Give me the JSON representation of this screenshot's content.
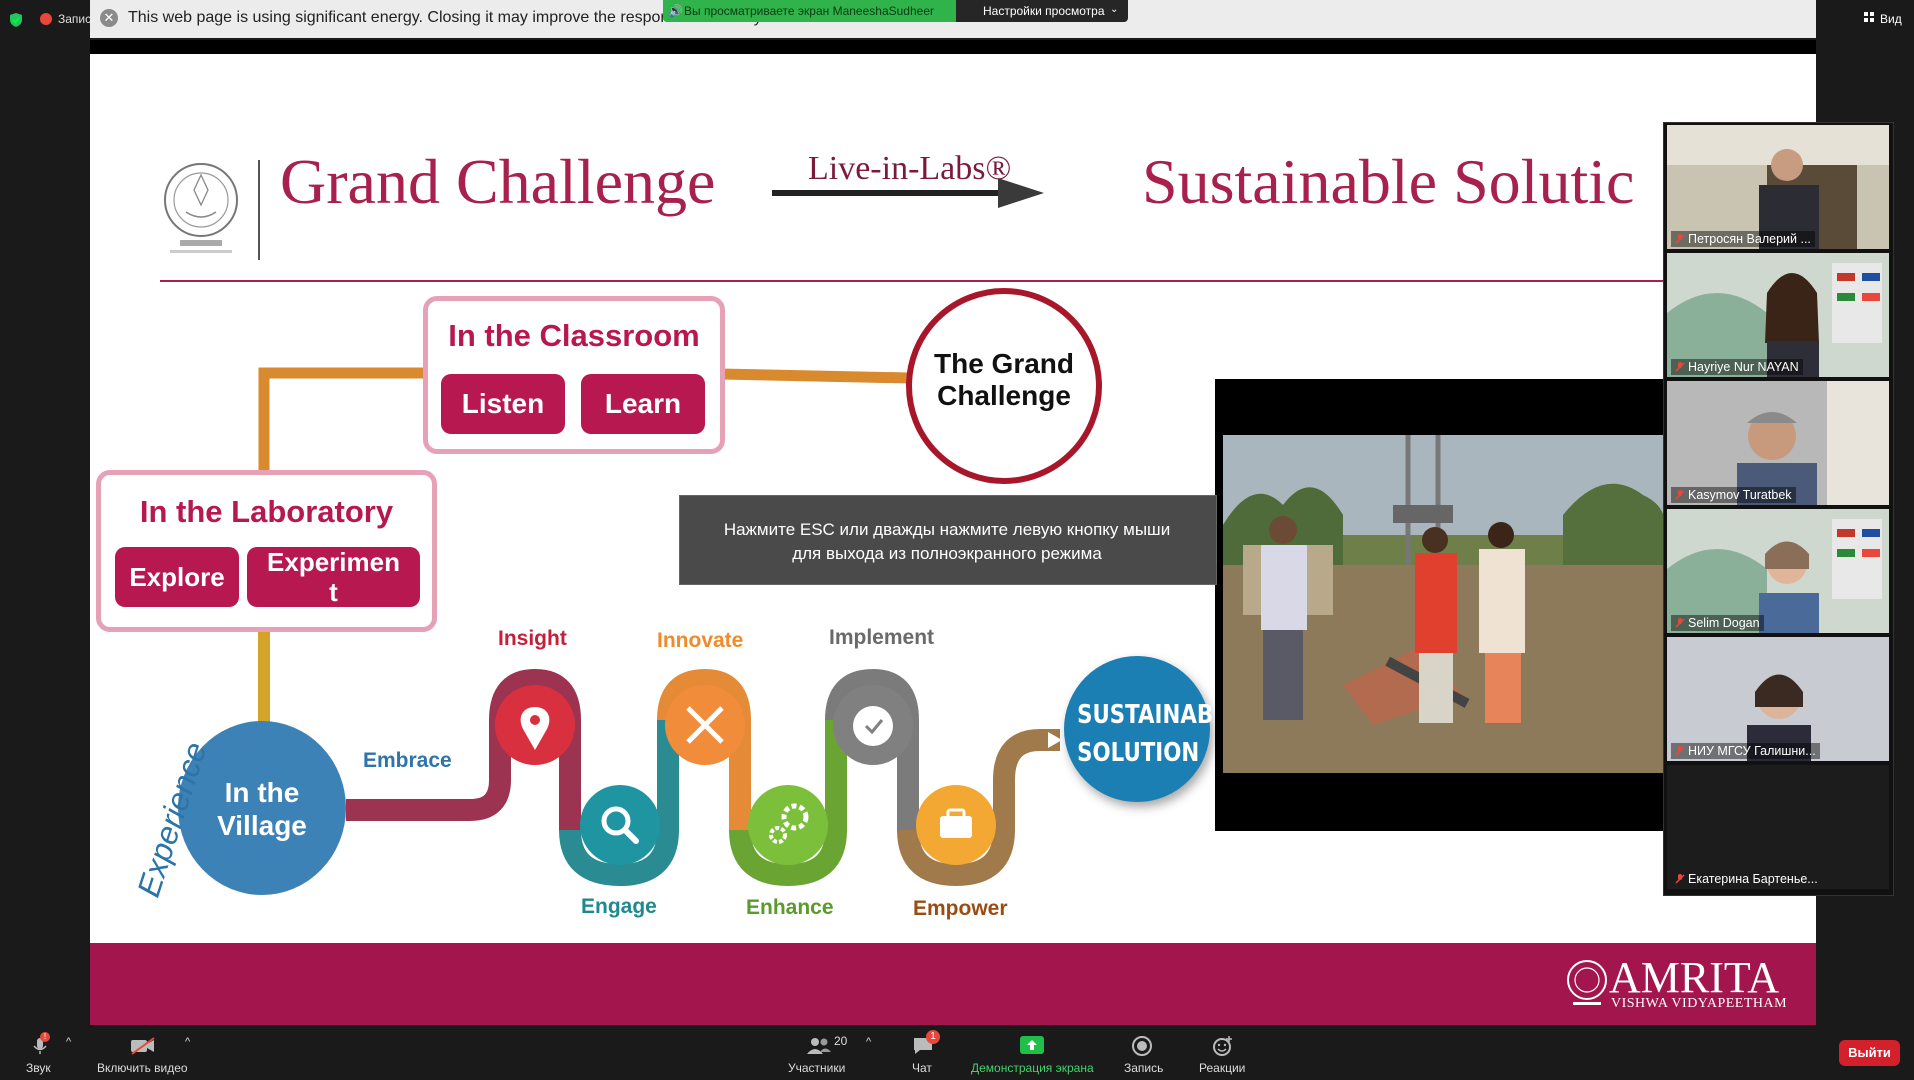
{
  "top": {
    "record_label": "Запись",
    "energy_warning": "This web page is using significant energy. Closing it may improve the responsiveness of your Mac.",
    "share_notice": "Вы просматриваете экран ManeeshaSudheer",
    "view_settings": "Настройки просмотра",
    "view_label": "Вид"
  },
  "slide": {
    "title_left": "Grand Challenge",
    "title_middle": "Live-in-Labs®",
    "title_right": "Sustainable Solutic",
    "classroom": {
      "title": "In the Classroom",
      "buttons": [
        "Listen",
        "Learn"
      ]
    },
    "laboratory": {
      "title": "In the Laboratory",
      "buttons": [
        "Explore",
        "Experimen\nt"
      ]
    },
    "grand_challenge_circle": "The Grand\nChallenge",
    "village_circle": "In the\nVillage",
    "experience_label": "Experience",
    "steps": {
      "embrace": "Embrace",
      "insight": "Insight",
      "innovate": "Innovate",
      "implement": "Implement",
      "engage": "Engage",
      "enhance": "Enhance",
      "empower": "Empower"
    },
    "sustainable_circle": "SUSTAINABLE\nSOLUTION",
    "esc_message": "Нажмите ESC или дважды нажмите левую кнопку мыши\nдля выхода из полноэкранного режима",
    "footer": {
      "brand": "AMRITA",
      "sub": "VISHWA VIDYAPEETHAM"
    }
  },
  "participants": [
    {
      "name": "Петросян Валерий ..."
    },
    {
      "name": "Hayriye Nur NAYAN"
    },
    {
      "name": "Kasymov Turatbek"
    },
    {
      "name": "Selim Dogan"
    },
    {
      "name": "НИУ МГСУ Галишни..."
    },
    {
      "name": "Екатерина Бартенье..."
    }
  ],
  "toolbar": {
    "audio": "Звук",
    "video": "Включить видео",
    "participants": "Участники",
    "participants_count": "20",
    "chat": "Чат",
    "chat_badge": "1",
    "share": "Демонстрация экрана",
    "record": "Запись",
    "reactions": "Реакции",
    "leave": "Выйти"
  },
  "colors": {
    "brand_magenta": "#a8204c",
    "button_magenta": "#b6184f",
    "footer_band": "#a2164d",
    "share_green": "#2fb34a",
    "leave_red": "#d3202a"
  }
}
